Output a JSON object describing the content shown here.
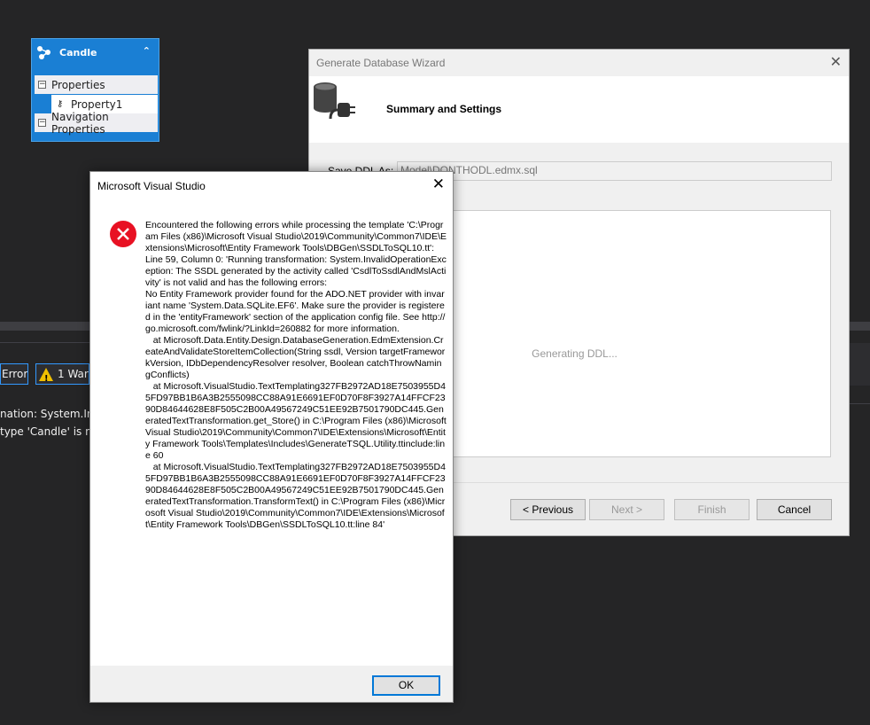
{
  "entity": {
    "title": "Candle",
    "collapse_glyph": "⌃",
    "properties_label": "Properties",
    "property1": "Property1",
    "nav_label": "Navigation Properties",
    "expand_glyph": "⊟"
  },
  "background": {
    "errors_btn": "Errors",
    "warnings_btn": "1 Warn",
    "output_line1": "nation: System.Inval",
    "output_line2": "type 'Candle' is not"
  },
  "wizard": {
    "title": "Generate Database Wizard",
    "heading": "Summary and Settings",
    "save_ddl_label": "Save DDL As:",
    "save_ddl_value": "Model\\DONTHODL.edmx.sql",
    "status_text": "Generating DDL...",
    "buttons": {
      "previous": "< Previous",
      "next": "Next >",
      "finish": "Finish",
      "cancel": "Cancel"
    }
  },
  "messagebox": {
    "title": "Microsoft Visual Studio",
    "message": "Encountered the following errors while processing the template 'C:\\Program Files (x86)\\Microsoft Visual Studio\\2019\\Community\\Common7\\IDE\\Extensions\\Microsoft\\Entity Framework Tools\\DBGen\\SSDLToSQL10.tt':\nLine 59, Column 0: 'Running transformation: System.InvalidOperationException: The SSDL generated by the activity called 'CsdlToSsdlAndMslActivity' is not valid and has the following errors:\nNo Entity Framework provider found for the ADO.NET provider with invariant name 'System.Data.SQLite.EF6'. Make sure the provider is registered in the 'entityFramework' section of the application config file. See http://go.microsoft.com/fwlink/?LinkId=260882 for more information.\n   at Microsoft.Data.Entity.Design.DatabaseGeneration.EdmExtension.CreateAndValidateStoreItemCollection(String ssdl, Version targetFrameworkVersion, IDbDependencyResolver resolver, Boolean catchThrowNamingConflicts)\n   at Microsoft.VisualStudio.TextTemplating327FB2972AD18E7503955D45FD97BB1B6A3B2555098CC88A91E6691EF0D70F8F3927A14FFCF2390D84644628E8F505C2B00A49567249C51EE92B7501790DC445.GeneratedTextTransformation.get_Store() in C:\\Program Files (x86)\\Microsoft Visual Studio\\2019\\Community\\Common7\\IDE\\Extensions\\Microsoft\\Entity Framework Tools\\Templates\\Includes\\GenerateTSQL.Utility.ttinclude:line 60\n   at Microsoft.VisualStudio.TextTemplating327FB2972AD18E7503955D45FD97BB1B6A3B2555098CC88A91E6691EF0D70F8F3927A14FFCF2390D84644628E8F505C2B00A49567249C51EE92B7501790DC445.GeneratedTextTransformation.TransformText() in C:\\Program Files (x86)\\Microsoft Visual Studio\\2019\\Community\\Common7\\IDE\\Extensions\\Microsoft\\Entity Framework Tools\\DBGen\\SSDLToSQL10.tt:line 84'",
    "ok": "OK",
    "close_glyph": "✕"
  },
  "colors": {
    "entity_blue": "#1a7fd4",
    "error_red": "#e81123",
    "accent": "#0078d7"
  }
}
